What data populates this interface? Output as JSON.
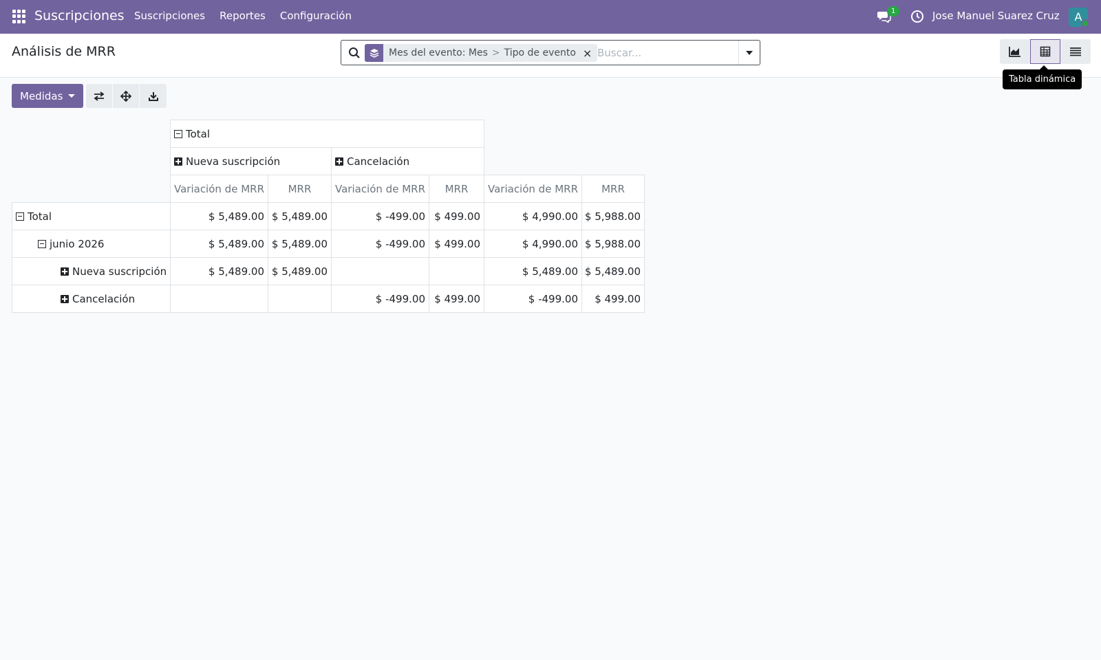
{
  "navbar": {
    "app_name": "Suscripciones",
    "menu": [
      "Suscripciones",
      "Reportes",
      "Configuración"
    ],
    "messages_badge": "1",
    "user_name": "Jose Manuel Suarez Cruz",
    "avatar_letter": "A",
    "accent_color": "#71639e"
  },
  "control_panel": {
    "title": "Análisis de MRR",
    "search": {
      "facet_part1": "Mes del evento: Mes",
      "facet_separator": ">",
      "facet_part2": "Tipo de evento",
      "facet_close": "×",
      "placeholder": "Buscar..."
    },
    "views": [
      "graph-icon",
      "pivot-icon",
      "list-icon"
    ],
    "active_view": "pivot-icon",
    "tooltip": "Tabla dinámica"
  },
  "toolbar": {
    "measures_label": "Medidas",
    "tools": [
      "flip-axis-icon",
      "expand-all-icon",
      "download-icon"
    ]
  },
  "pivot": {
    "col_total": "Total",
    "col_groups": [
      "Nueva suscripción",
      "Cancelación"
    ],
    "measures": [
      "Variación de MRR",
      "MRR",
      "Variación de MRR",
      "MRR",
      "Variación de MRR",
      "MRR"
    ],
    "rows": [
      {
        "label": "Total",
        "values": [
          "$ 5,489.00",
          "$ 5,489.00",
          "$ -499.00",
          "$ 499.00",
          "$ 4,990.00",
          "$ 5,988.00"
        ]
      },
      {
        "label": "junio 2026",
        "values": [
          "$ 5,489.00",
          "$ 5,489.00",
          "$ -499.00",
          "$ 499.00",
          "$ 4,990.00",
          "$ 5,988.00"
        ]
      },
      {
        "label": "Nueva suscripción",
        "values": [
          "$ 5,489.00",
          "$ 5,489.00",
          "",
          "",
          "$ 5,489.00",
          "$ 5,489.00"
        ]
      },
      {
        "label": "Cancelación",
        "values": [
          "",
          "",
          "$ -499.00",
          "$ 499.00",
          "$ -499.00",
          "$ 499.00"
        ]
      }
    ]
  }
}
